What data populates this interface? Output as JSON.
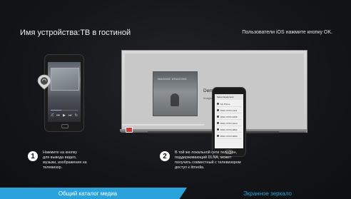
{
  "header": {
    "device_title": "Имя устройства:ТВ в гостиной",
    "ios_hint": "Пользователи iOS нажмите кнопку OK."
  },
  "tv": {
    "album_text": "IMAGINE DRAGONS",
    "song_title": "Demons",
    "song_artist": "Imagine Dragons"
  },
  "phone2": {
    "list_header": "Select Equipment",
    "list_items": [
      "My Phone",
      "DMC-XXXX-1421",
      "DMC-XXXX-1605",
      "DMC-XXXX-2213",
      "DMC-XXXX-4802",
      "DMC-XXXX-5090"
    ]
  },
  "steps": [
    {
      "number": "1",
      "text": "Нажмите на кнопку\nдля вывода видео,\nмузыки, изображения на\nтелевизор."
    },
    {
      "number": "2",
      "text": "В той же локальной сети телефон,\nподдерживающий DLNA, может\nполучить совместный с телевизором\nдоступ к  Itmedia."
    }
  ],
  "tabs": {
    "active": "Общий каталог медиа",
    "inactive": "Экранное зеркало"
  },
  "colors": {
    "accent": "#2aa3dc",
    "background": "#111214"
  }
}
